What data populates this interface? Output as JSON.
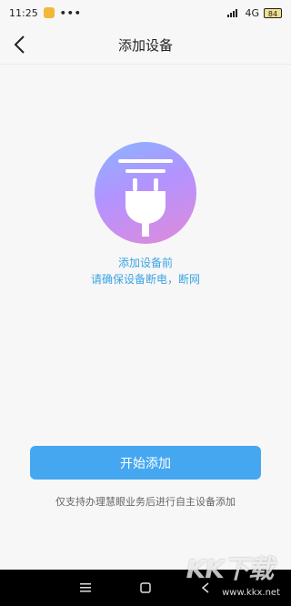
{
  "status_bar": {
    "time": "11:25",
    "dots": "•••",
    "network": "4G",
    "battery": "84"
  },
  "header": {
    "title": "添加设备"
  },
  "main": {
    "hint_line1": "添加设备前",
    "hint_line2": "请确保设备断电，断网",
    "start_button": "开始添加",
    "footnote": "仅支持办理慧眼业务后进行自主设备添加"
  },
  "watermark": {
    "logo": "KK下载",
    "url": "www.kkx.net"
  },
  "colors": {
    "accent": "#45a7f0",
    "hint_text": "#3da4e3"
  },
  "icons": {
    "hero": "power-plug-icon",
    "back": "back-arrow-icon"
  }
}
